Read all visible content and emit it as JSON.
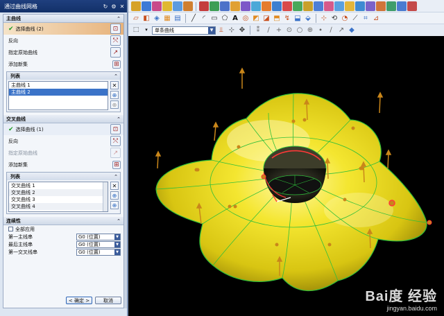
{
  "dialog": {
    "title": "通过曲线网格",
    "primary": {
      "header": "主曲线",
      "select_curve": "选择曲线 (2)",
      "reverse": "反向",
      "specify_origin": "指定原始曲线",
      "add_new_set": "添加新集",
      "list_header": "列表",
      "items": [
        "主曲线 1",
        "主曲线 2"
      ]
    },
    "cross": {
      "header": "交叉曲线",
      "select_curve": "选择曲线 (1)",
      "reverse": "反向",
      "specify_origin": "指定原始曲线",
      "add_new_set": "添加新集",
      "list_header": "列表",
      "items": [
        "交叉曲线 1",
        "交叉曲线 2",
        "交叉曲线 3",
        "交叉曲线 4"
      ]
    },
    "continuity": {
      "header": "连续性",
      "apply_all": "全部应用",
      "rows": [
        {
          "label": "第一主线串",
          "value": "G0 (位置)"
        },
        {
          "label": "最后主线串",
          "value": "G0 (位置)"
        },
        {
          "label": "第一交叉线串",
          "value": "G0 (位置)"
        }
      ]
    },
    "ok": "< 确定 >",
    "cancel": "取消"
  },
  "toolbar": {
    "curve_rule": "单条曲线"
  },
  "watermark": {
    "brand": "Bai度 经验",
    "url": "jingyan.baidu.com"
  },
  "colors": {
    "surface": "#f2e31c",
    "wire": "#2fbf3a",
    "accent_bar": "#e7b27a",
    "selection": "#3b73c8"
  }
}
